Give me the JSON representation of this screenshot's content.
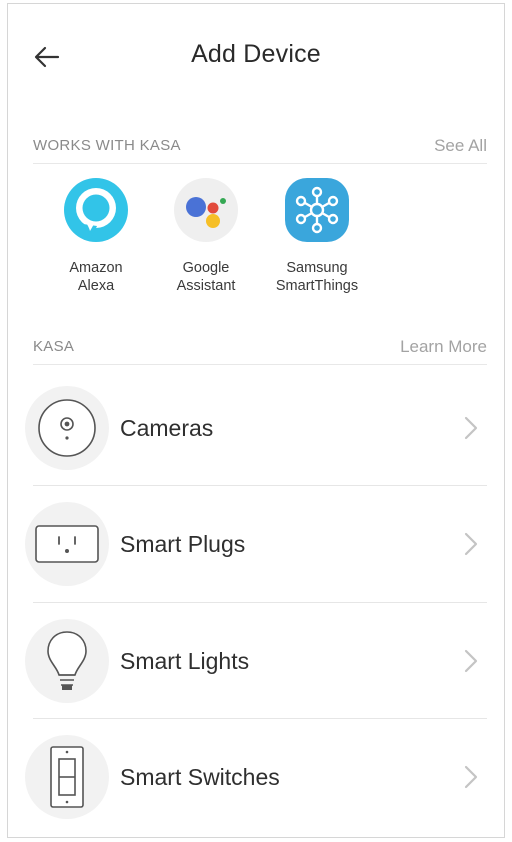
{
  "header": {
    "title": "Add Device"
  },
  "works_with": {
    "label": "WORKS WITH KASA",
    "see_all": "See All",
    "partners": [
      {
        "name": "Amazon\nAlexa",
        "icon": "alexa-logo-icon",
        "color": "#32c4e8"
      },
      {
        "name": "Google\nAssistant",
        "icon": "google-assistant-logo-icon"
      },
      {
        "name": "Samsung\nSmartThings",
        "icon": "smartthings-logo-icon",
        "color": "#3aa6dc"
      }
    ]
  },
  "kasa": {
    "label": "KASA",
    "learn_more": "Learn More",
    "items": [
      {
        "label": "Cameras",
        "icon": "camera-icon"
      },
      {
        "label": "Smart Plugs",
        "icon": "plug-icon"
      },
      {
        "label": "Smart Lights",
        "icon": "bulb-icon"
      },
      {
        "label": "Smart Switches",
        "icon": "switch-icon"
      }
    ]
  },
  "colors": {
    "muted_text": "#8a8a8a",
    "link_text": "#a3a3a3",
    "icon_bg": "#f2f2f2",
    "divider": "#e6e6e6"
  }
}
